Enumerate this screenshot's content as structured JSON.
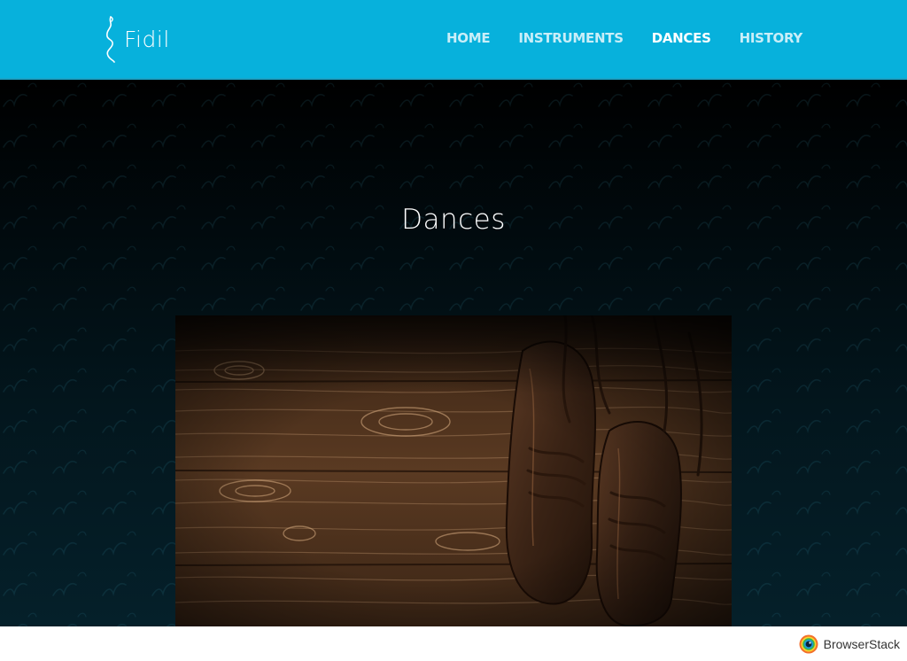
{
  "brand": {
    "name": "Fidil",
    "header_color": "#07b1dc"
  },
  "nav": {
    "items": [
      {
        "label": "HOME",
        "active": false
      },
      {
        "label": "INSTRUMENTS",
        "active": false
      },
      {
        "label": "DANCES",
        "active": true
      },
      {
        "label": "HISTORY",
        "active": false
      }
    ]
  },
  "hero": {
    "title": "Dances"
  },
  "photo": {
    "subject": "irish-dance-shoes-on-wood"
  },
  "footer": {
    "badge_text": "BrowserStack",
    "badge_icon": "browserstack-logo-icon"
  }
}
